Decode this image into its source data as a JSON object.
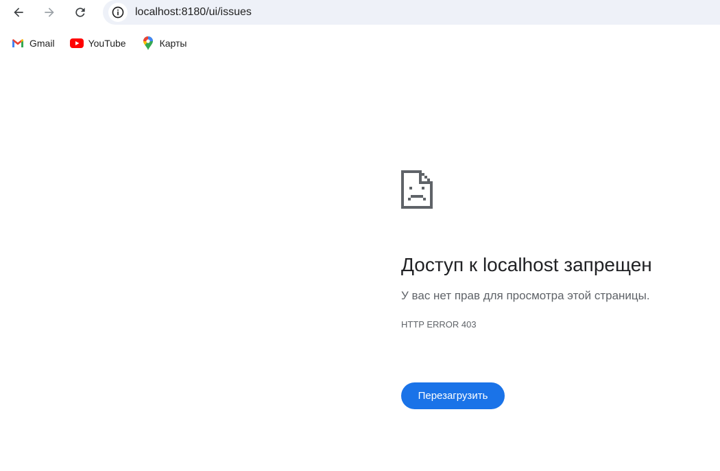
{
  "browser": {
    "url": "localhost:8180/ui/issues",
    "nav": {
      "back_icon": "arrow-left-icon",
      "forward_icon": "arrow-right-icon",
      "reload_icon": "reload-icon",
      "info_icon": "info-circle-icon"
    },
    "bookmarks": [
      {
        "label": "Gmail",
        "icon": "gmail-icon"
      },
      {
        "label": "YouTube",
        "icon": "youtube-icon"
      },
      {
        "label": "Карты",
        "icon": "maps-pin-icon"
      }
    ]
  },
  "error": {
    "icon": "sad-document-icon",
    "title": "Доступ к localhost запрещен",
    "description": "У вас нет прав для просмотра этой страницы.",
    "code": "HTTP ERROR 403",
    "reload_label": "Перезагрузить"
  },
  "colors": {
    "accent": "#1a73e8",
    "omnibox_bg": "#eef1f8",
    "title_text": "#202124",
    "secondary_text": "#5f6368"
  }
}
